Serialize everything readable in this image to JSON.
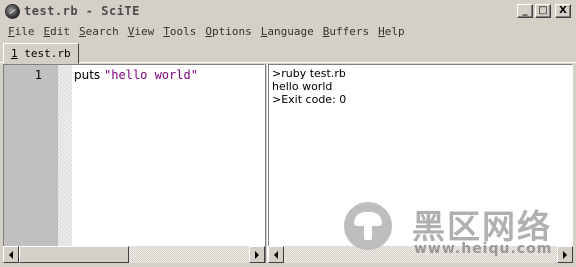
{
  "window": {
    "title": "test.rb - SciTE",
    "controls": {
      "minimize": "_",
      "maximize": "□",
      "close": "X"
    }
  },
  "menu": [
    {
      "accel": "F",
      "rest": "ile"
    },
    {
      "accel": "E",
      "rest": "dit"
    },
    {
      "accel": "S",
      "rest": "earch"
    },
    {
      "accel": "V",
      "rest": "iew"
    },
    {
      "accel": "T",
      "rest": "ools"
    },
    {
      "accel": "O",
      "rest": "ptions"
    },
    {
      "accel": "L",
      "rest": "anguage"
    },
    {
      "accel": "B",
      "rest": "uffers"
    },
    {
      "accel": "H",
      "rest": "elp"
    }
  ],
  "tabs": [
    {
      "index": "1",
      "label": "test.rb"
    }
  ],
  "editor": {
    "line_number": "1",
    "code_keyword": "puts ",
    "code_string": "\"hello world\""
  },
  "output": {
    "lines": [
      ">ruby test.rb",
      "hello world",
      ">Exit code: 0"
    ]
  },
  "watermark": {
    "text_cn": "黑区网络",
    "url": "www.heiqu.com"
  },
  "colors": {
    "chrome": "#d4d0c8",
    "string": "#7f007f",
    "gutter": "#c0c0c0"
  }
}
